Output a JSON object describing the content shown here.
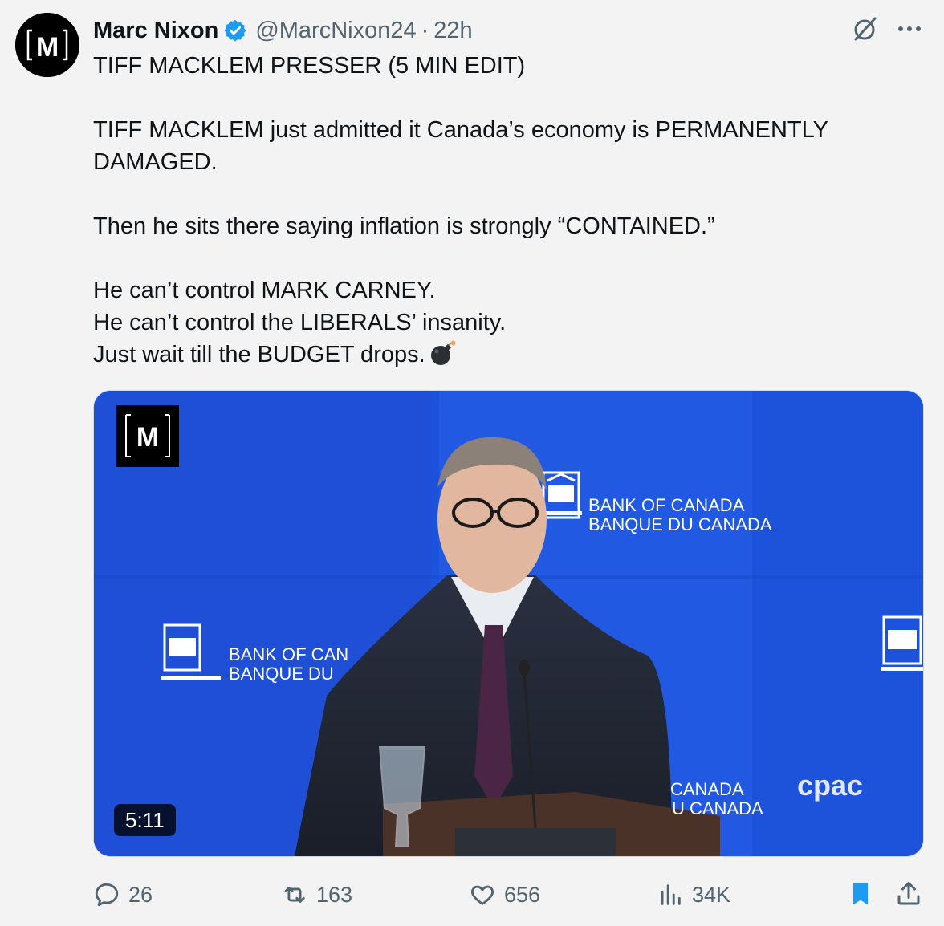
{
  "tweet": {
    "author": {
      "name": "Marc Nixon",
      "handle": "@MarcNixon24",
      "time": "22h",
      "separator": "·",
      "avatar_letter": "M"
    },
    "lines": [
      "TIFF MACKLEM PRESSER (5 MIN EDIT)",
      "",
      "TIFF MACKLEM just admitted it Canada’s economy is PERMANENTLY DAMAGED.",
      "",
      "Then he sits there saying inflation is strongly “CONTAINED.”",
      "",
      "He can’t control MARK CARNEY.",
      "He can’t control the LIBERALS’ insanity.",
      "Just wait till the BUDGET drops."
    ],
    "trailing_emoji": "bomb-icon",
    "media": {
      "type": "video",
      "duration": "5:11",
      "watermark_letter": "M",
      "backdrop_text_1": "BANK OF CANADA",
      "backdrop_text_2": "BANQUE DU CANADA",
      "backdrop_text_left_1": "BANK OF CAN",
      "backdrop_text_left_2": "BANQUE DU",
      "backdrop_text_bottom_1": "CANADA",
      "backdrop_text_bottom_2": "U CANADA",
      "broadcaster_logo": "cpac"
    },
    "metrics": {
      "replies": "26",
      "reposts": "163",
      "likes": "656",
      "views": "34K"
    },
    "colors": {
      "accent": "#1d9bf0",
      "muted": "#536471",
      "backdrop_blue": "#1f55e0"
    }
  }
}
